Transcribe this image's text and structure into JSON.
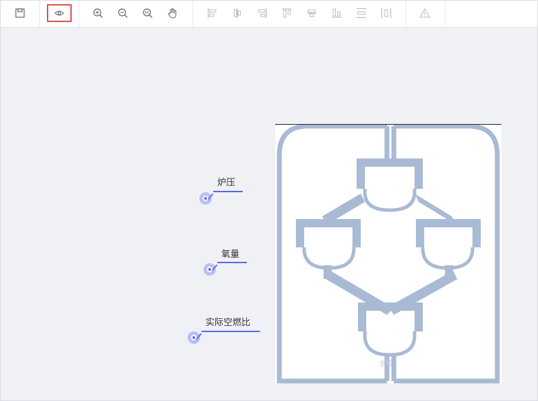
{
  "toolbar": {
    "file_group": [
      {
        "name": "save-icon",
        "active": false
      }
    ],
    "view_group": [
      {
        "name": "preview-eye-icon",
        "active": true
      }
    ],
    "zoom_group": [
      {
        "name": "zoom-in-icon"
      },
      {
        "name": "zoom-out-icon"
      },
      {
        "name": "zoom-actual-icon"
      },
      {
        "name": "pan-hand-icon"
      }
    ],
    "align_group": [
      {
        "name": "align-left-icon"
      },
      {
        "name": "align-center-horizontal-icon"
      },
      {
        "name": "align-right-icon"
      },
      {
        "name": "align-top-icon"
      },
      {
        "name": "align-middle-vertical-icon"
      },
      {
        "name": "align-bottom-icon"
      },
      {
        "name": "distribute-vertical-icon"
      },
      {
        "name": "distribute-horizontal-icon"
      }
    ],
    "extra_group": [
      {
        "name": "warning-triangle-icon"
      }
    ],
    "accent_color": "#d9534f",
    "icon_color": "#666666",
    "disabled_icon_color": "#bbbbbb"
  },
  "sensors": [
    {
      "label": "炉压"
    },
    {
      "label": "氧量"
    },
    {
      "label": "实际空燃比"
    }
  ],
  "sensor_color": "#5b67e6",
  "diagram": {
    "caption": "主管",
    "pipe_color": "#a9bad4"
  }
}
